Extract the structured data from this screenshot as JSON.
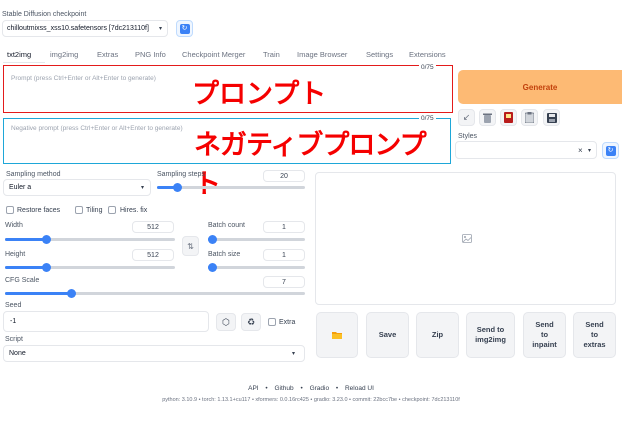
{
  "checkpoint": {
    "label": "Stable Diffusion checkpoint",
    "value": "chilloutmixss_xss10.safetensors [7dc213110f]"
  },
  "tabs": [
    "txt2img",
    "img2img",
    "Extras",
    "PNG Info",
    "Checkpoint Merger",
    "Train",
    "Image Browser",
    "Settings",
    "Extensions"
  ],
  "prompt": {
    "placeholder": "Prompt (press Ctrl+Enter or Alt+Enter to generate)",
    "counter": "0/75",
    "annotation": "プロンプト"
  },
  "negative_prompt": {
    "placeholder": "Negative prompt (press Ctrl+Enter or Alt+Enter to generate)",
    "counter": "0/75",
    "annotation": "ネガティブプロンプト"
  },
  "generate_label": "Generate",
  "styles_label": "Styles",
  "styles_clear": "×",
  "sampling": {
    "method_label": "Sampling method",
    "method_value": "Euler a",
    "steps_label": "Sampling steps",
    "steps_value": "20"
  },
  "checks": {
    "restore_faces": "Restore faces",
    "tiling": "Tiling",
    "hires_fix": "Hires. fix"
  },
  "width": {
    "label": "Width",
    "value": "512"
  },
  "height": {
    "label": "Height",
    "value": "512"
  },
  "batch_count": {
    "label": "Batch count",
    "value": "1"
  },
  "batch_size": {
    "label": "Batch size",
    "value": "1"
  },
  "cfg": {
    "label": "CFG Scale",
    "value": "7"
  },
  "seed": {
    "label": "Seed",
    "value": "-1",
    "extra_label": "Extra"
  },
  "script": {
    "label": "Script",
    "value": "None"
  },
  "output_buttons": {
    "save": "Save",
    "zip": "Zip",
    "send_img2img": [
      "Send to",
      "img2img"
    ],
    "send_inpaint": [
      "Send",
      "to",
      "inpaint"
    ],
    "send_extras": [
      "Send",
      "to",
      "extras"
    ]
  },
  "footer": {
    "links": [
      "API",
      "Github",
      "Gradio",
      "Reload UI"
    ],
    "sep": "•",
    "versions": "python: 3.10.9  •  torch: 1.13.1+cu117  •  xformers: 0.0.16rc425  •  gradio: 3.23.0  •  commit: 22bcc7be  •  checkpoint: 7dc213110f"
  },
  "colors": {
    "accent": "#3b82f6",
    "generate_bg": "#fdba74",
    "generate_text": "#c2410c",
    "prompt_outline": "#e31b1b",
    "negative_outline": "#1ea7d8",
    "annotation_text": "#f50000"
  }
}
